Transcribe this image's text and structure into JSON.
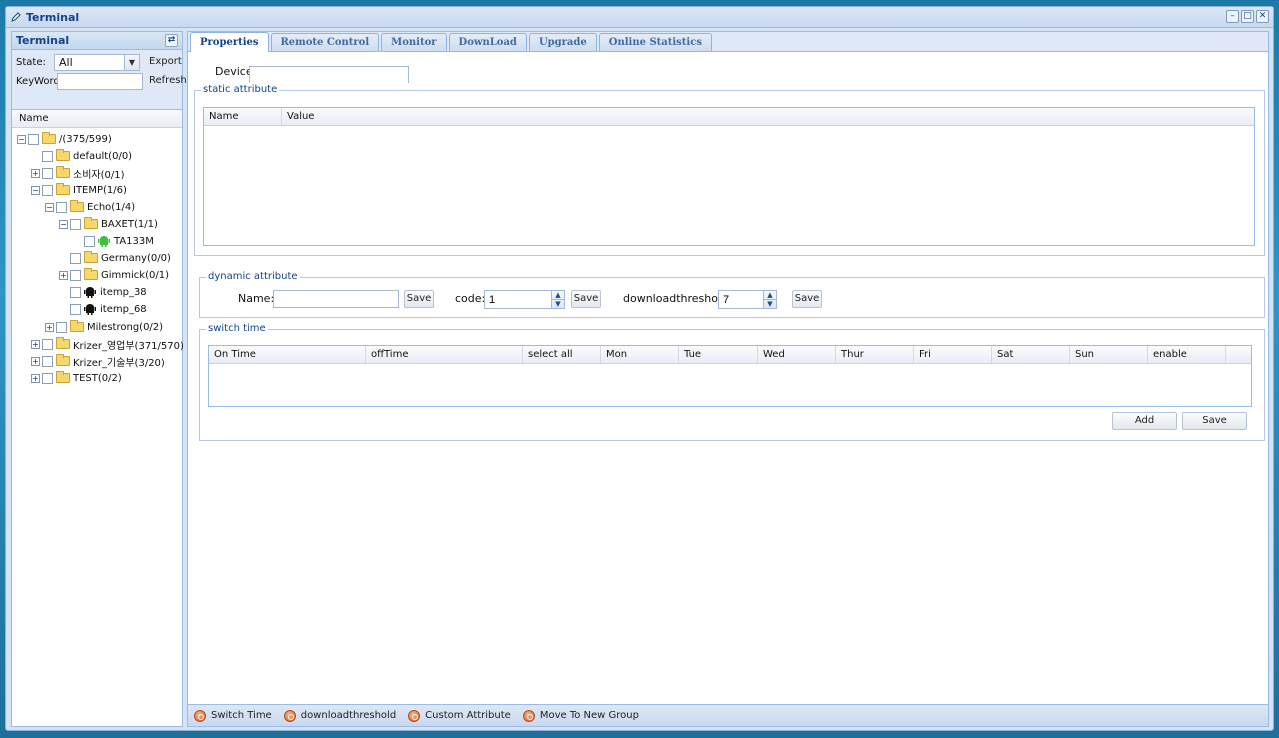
{
  "window": {
    "title": "Terminal"
  },
  "left": {
    "header": "Terminal",
    "state_label": "State:",
    "state_value": "All",
    "export_label": "Export",
    "keywords_label": "KeyWords",
    "keywords_value": "",
    "refresh_label": "Refresh",
    "tree_column": "Name",
    "tree": [
      {
        "label": "/(375/599)",
        "toggle": "-",
        "icon": "folder"
      },
      {
        "label": "default(0/0)",
        "toggle": "",
        "icon": "folder"
      },
      {
        "label": "소비자(0/1)",
        "toggle": "+",
        "icon": "folder"
      },
      {
        "label": "ITEMP(1/6)",
        "toggle": "-",
        "icon": "folder"
      },
      {
        "label": "Echo(1/4)",
        "toggle": "-",
        "icon": "folder"
      },
      {
        "label": "BAXET(1/1)",
        "toggle": "-",
        "icon": "folder"
      },
      {
        "label": "TA133M",
        "toggle": "",
        "icon": "android-green"
      },
      {
        "label": "Germany(0/0)",
        "toggle": "",
        "icon": "folder"
      },
      {
        "label": "Gimmick(0/1)",
        "toggle": "+",
        "icon": "folder"
      },
      {
        "label": "itemp_38",
        "toggle": "",
        "icon": "android-black"
      },
      {
        "label": "itemp_68",
        "toggle": "",
        "icon": "android-black"
      },
      {
        "label": "Milestrong(0/2)",
        "toggle": "+",
        "icon": "folder"
      },
      {
        "label": "Krizer_영업부(371/570)",
        "toggle": "+",
        "icon": "folder"
      },
      {
        "label": "Krizer_기술부(3/20)",
        "toggle": "+",
        "icon": "folder"
      },
      {
        "label": "TEST(0/2)",
        "toggle": "+",
        "icon": "folder"
      }
    ]
  },
  "tabs": [
    "Properties",
    "Remote Control",
    "Monitor",
    "DownLoad",
    "Upgrade",
    "Online Statistics"
  ],
  "properties": {
    "device_label": "Device",
    "device_value": "",
    "static_legend": "static attribute",
    "static_columns": [
      "Name",
      "Value"
    ],
    "dynamic_legend": "dynamic attribute",
    "name_label": "Name:",
    "name_value": "",
    "code_label": "code:",
    "code_value": "1",
    "threshold_label": "downloadthreshold:",
    "threshold_value": "7",
    "save_label": "Save",
    "switch_legend": "switch time",
    "switch_columns": [
      "On Time",
      "offTime",
      "select all",
      "Mon",
      "Tue",
      "Wed",
      "Thur",
      "Fri",
      "Sat",
      "Sun",
      "enable"
    ],
    "add_label": "Add"
  },
  "bottom_bar": [
    "Switch Time",
    "downloadthreshold",
    "Custom Attribute",
    "Move To New Group"
  ]
}
